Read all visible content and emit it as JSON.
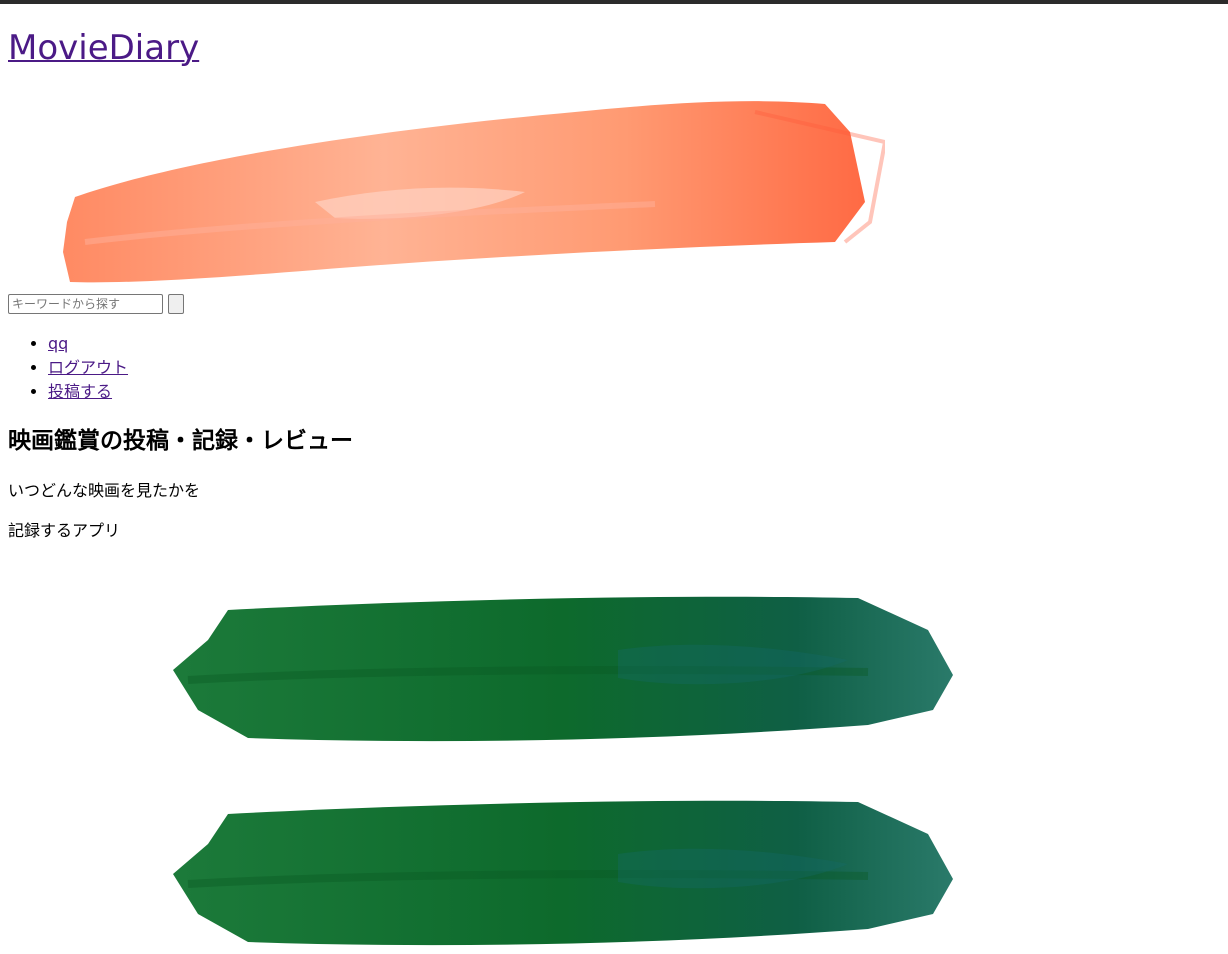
{
  "site": {
    "title": "MovieDiary"
  },
  "search": {
    "placeholder": "キーワードから探す",
    "value": "",
    "button_label": ""
  },
  "nav": {
    "items": [
      {
        "label": "qq"
      },
      {
        "label": "ログアウト"
      },
      {
        "label": "投稿する"
      }
    ]
  },
  "hero": {
    "title": "映画鑑賞の投稿・記録・レビュー",
    "line1": "いつどんな映画を見たかを",
    "line2": "記録するアプリ"
  },
  "colors": {
    "topbar": "#2b2b2b",
    "link": "#4b1a86",
    "brush_orange": "#ff7e55",
    "brush_green": "#0b6b2a"
  },
  "icons": {
    "header_decoration": "orange-brush-stroke",
    "section_decoration": "green-brush-stroke"
  }
}
